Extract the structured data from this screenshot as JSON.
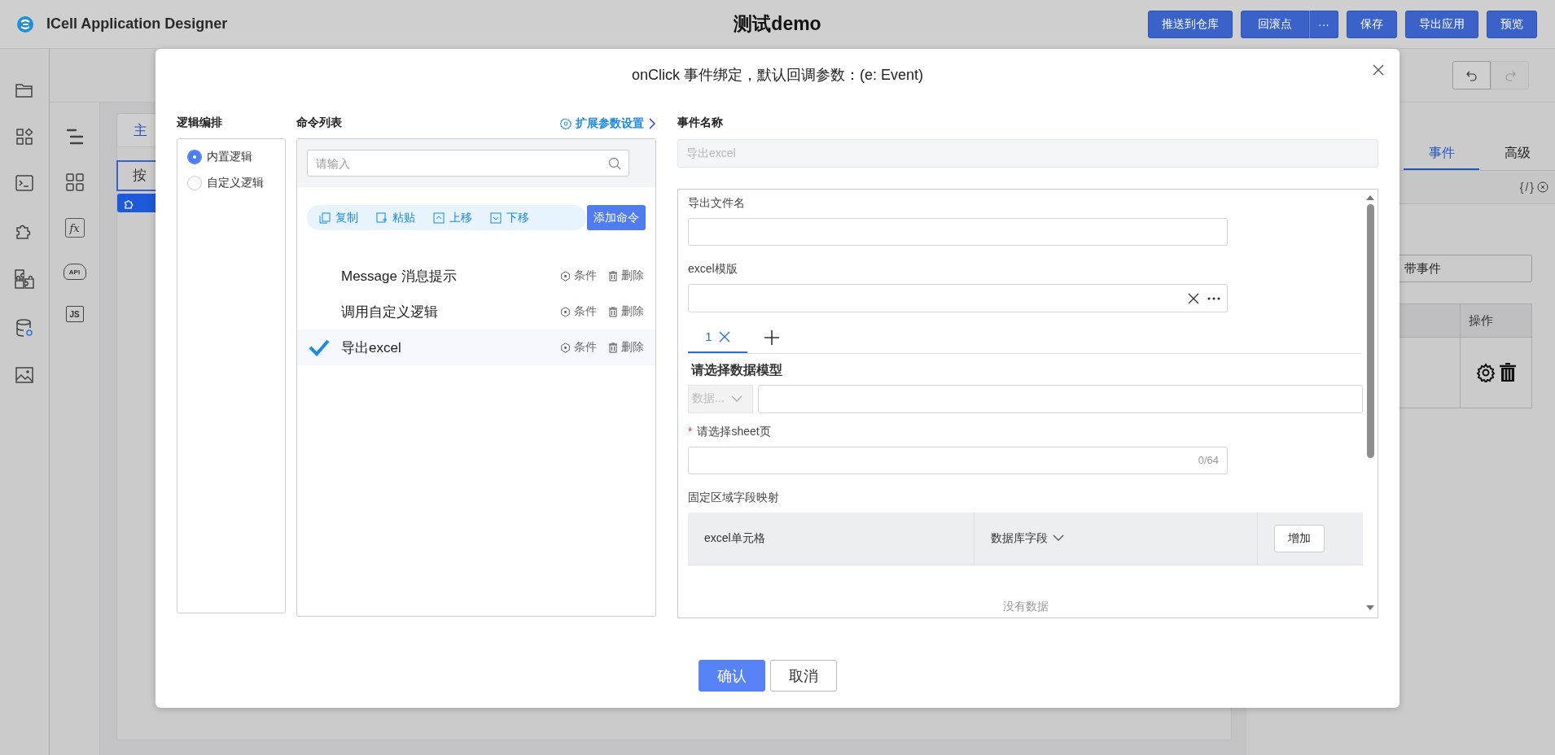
{
  "app": {
    "name": "ICell Application Designer",
    "document_title": "测试demo",
    "buttons": [
      {
        "label": "推送到仓库",
        "kind": "plain"
      },
      {
        "label": "回滚点",
        "kind": "split",
        "menu": "···"
      },
      {
        "label": "保存",
        "kind": "plain"
      },
      {
        "label": "导出应用",
        "kind": "plain"
      },
      {
        "label": "预览",
        "kind": "plain"
      }
    ]
  },
  "tool_rail": [
    {
      "kind": "outline"
    },
    {
      "kind": "grid"
    },
    {
      "kind": "formula",
      "label": "fx"
    },
    {
      "kind": "api",
      "label": "API"
    },
    {
      "kind": "js",
      "label": "JS"
    }
  ],
  "canvas": {
    "tab": "主",
    "component": "按"
  },
  "properties": {
    "tabs": [
      {
        "label": "事件",
        "selected": true
      },
      {
        "label": "高级",
        "selected": false
      }
    ],
    "code_label": "{/}",
    "event_button": "带事件",
    "table_header": "操作"
  },
  "dialog": {
    "title": "onClick 事件绑定，默认回调参数：(e: Event)",
    "logic": {
      "label": "逻辑编排",
      "options": [
        {
          "label": "内置逻辑",
          "selected": true
        },
        {
          "label": "自定义逻辑",
          "selected": false
        }
      ]
    },
    "commands": {
      "label": "命令列表",
      "settings_link": "扩展参数设置",
      "search": {
        "placeholder": "请输入"
      },
      "actions": [
        {
          "label": "复制",
          "kind": "copy"
        },
        {
          "label": "粘贴",
          "kind": "paste"
        },
        {
          "label": "上移",
          "kind": "up"
        },
        {
          "label": "下移",
          "kind": "down"
        }
      ],
      "add_button": "添加命令",
      "items": [
        {
          "name": "Message 消息提示",
          "selected": false,
          "condition": "条件",
          "delete": "删除"
        },
        {
          "name": "调用自定义逻辑",
          "selected": false,
          "condition": "条件",
          "delete": "删除"
        },
        {
          "name": "导出excel",
          "selected": true,
          "condition": "条件",
          "delete": "删除"
        }
      ]
    },
    "event": {
      "label": "事件名称",
      "value": "导出excel",
      "disabled": true
    },
    "form": {
      "file_name": {
        "label": "导出文件名"
      },
      "template": {
        "label": "excel模版"
      },
      "sheet_tabs": [
        {
          "label": "1",
          "selected": true
        }
      ],
      "model": {
        "label": "请选择数据模型",
        "select_placeholder": "数据..."
      },
      "sheet": {
        "label": "请选择sheet页",
        "required_mark": "*",
        "counter": "0/64"
      },
      "mapping": {
        "label": "固定区域字段映射",
        "columns": [
          "excel单元格",
          "数据库字段"
        ],
        "add_button": "增加",
        "empty": "没有数据"
      }
    },
    "buttons": [
      {
        "label": "确认",
        "kind": "primary"
      },
      {
        "label": "取消",
        "kind": "default"
      }
    ]
  }
}
